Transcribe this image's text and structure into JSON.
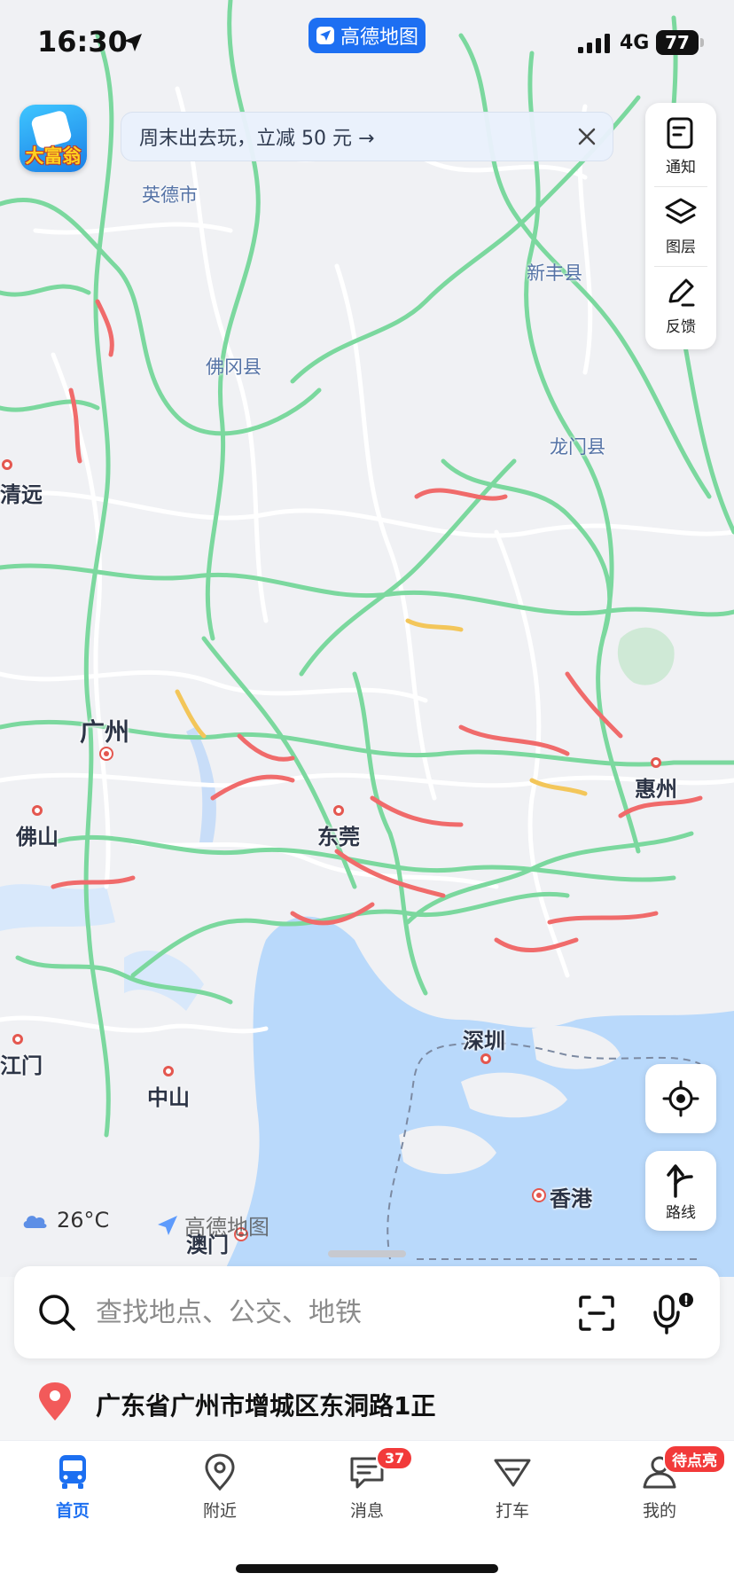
{
  "status_bar": {
    "time": "16:30",
    "app_pill": "高德地图",
    "network": "4G",
    "battery": "77"
  },
  "game_icon": {
    "label": "大富翁"
  },
  "promo": {
    "text": "周末出去玩，立减 50 元 →"
  },
  "tools": {
    "notify": "通知",
    "layers": "图层",
    "feedback": "反馈"
  },
  "route_button": {
    "label": "路线"
  },
  "map_labels": {
    "yingde": "英德市",
    "xinfeng": "新丰县",
    "fogang": "佛冈县",
    "longmen": "龙门县",
    "qingyuan": "清远",
    "guangzhou": "广州",
    "huizhou": "惠州",
    "foshan": "佛山",
    "dongguan": "东莞",
    "shenzhen": "深圳",
    "jiangmen": "江门",
    "zhongshan": "中山",
    "hongkong": "香港",
    "macau": "澳门"
  },
  "weather": {
    "icon": "cloud-icon",
    "temp": "26°C"
  },
  "watermark": "高德地图",
  "search": {
    "placeholder": "查找地点、公交、地铁"
  },
  "location": {
    "address": "广东省广州市增城区东洞路1正"
  },
  "tabs": [
    {
      "label": "首页",
      "icon": "bus-icon",
      "active": true
    },
    {
      "label": "附近",
      "icon": "location-pin-icon"
    },
    {
      "label": "消息",
      "icon": "message-icon",
      "badge": "37"
    },
    {
      "label": "打车",
      "icon": "taxi-icon"
    },
    {
      "label": "我的",
      "icon": "user-icon",
      "badge": "待点亮"
    }
  ],
  "colors": {
    "accent": "#1c6ff1",
    "road_green": "#7bd89e",
    "road_red": "#f06b6b",
    "water": "#b9d9fb",
    "badge_red": "#f23a3a"
  }
}
